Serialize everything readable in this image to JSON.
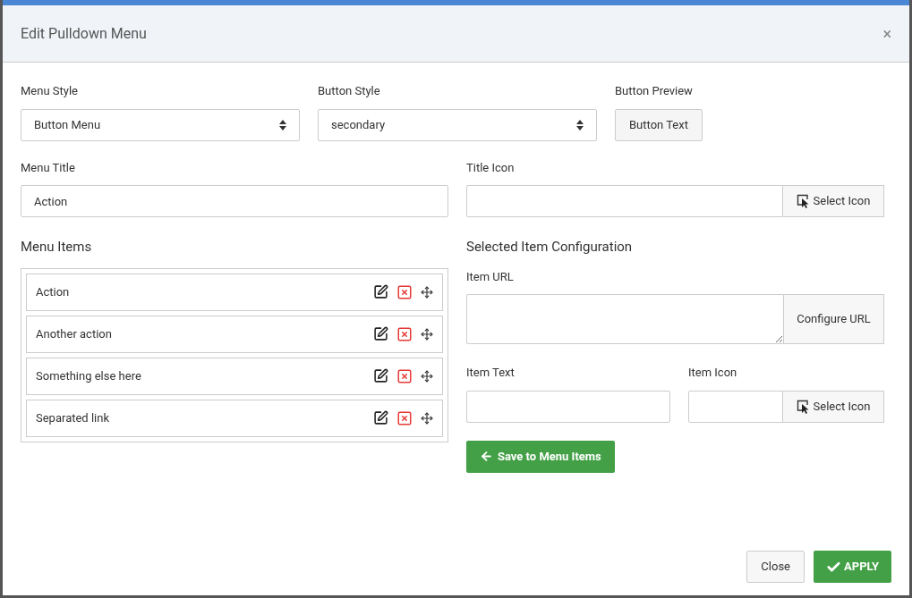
{
  "dialog": {
    "title": "Edit Pulldown Menu",
    "close_glyph": "×"
  },
  "menu_style": {
    "label": "Menu Style",
    "value": "Button Menu"
  },
  "button_style": {
    "label": "Button Style",
    "value": "secondary"
  },
  "button_preview": {
    "label": "Button Preview",
    "button": "Button Text"
  },
  "menu_title": {
    "label": "Menu Title",
    "value": "Action"
  },
  "title_icon": {
    "label": "Title Icon",
    "button": "Select Icon"
  },
  "menu_items": {
    "heading": "Menu Items",
    "items": [
      {
        "text": "Action"
      },
      {
        "text": "Another action"
      },
      {
        "text": "Something else here"
      },
      {
        "text": "Separated link"
      }
    ]
  },
  "config": {
    "heading": "Selected Item Configuration",
    "item_url_label": "Item URL",
    "configure_button": "Configure URL",
    "item_text_label": "Item Text",
    "item_icon_label": "Item Icon",
    "select_icon_button": "Select Icon",
    "save_button": "Save to Menu Items"
  },
  "footer": {
    "close": "Close",
    "apply": "APPLY"
  }
}
